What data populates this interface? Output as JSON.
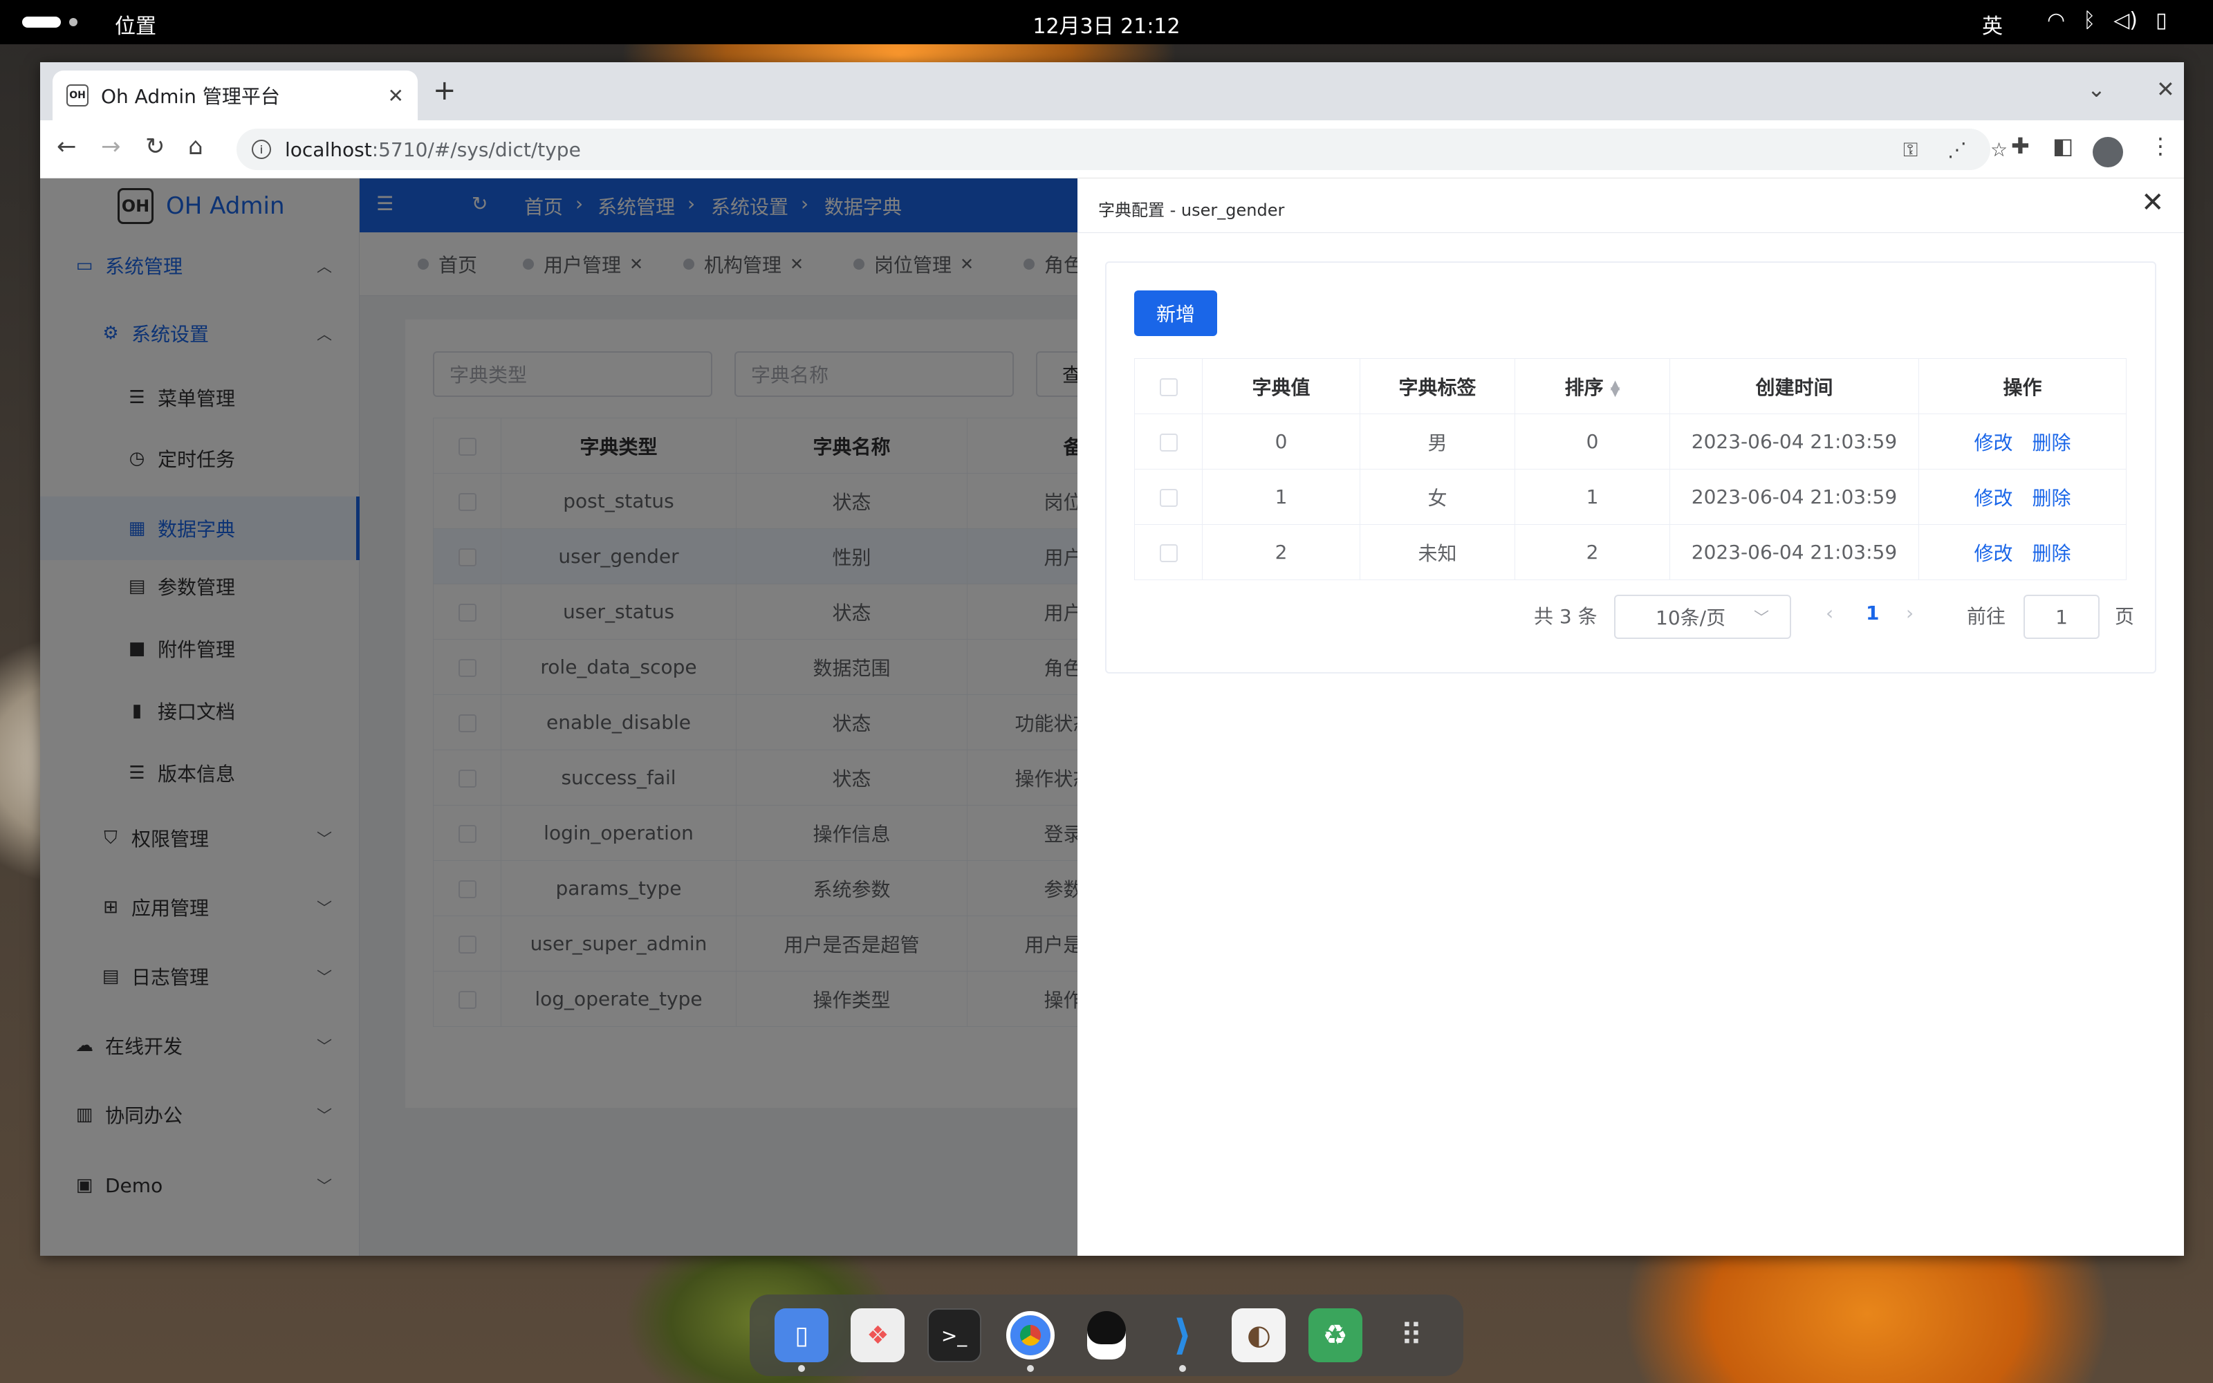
{
  "topbar": {
    "location": "位置",
    "datetime": "12月3日  21:12",
    "ime": "英"
  },
  "browser": {
    "tab_title": "Oh Admin 管理平台",
    "tab_favicon": "OH",
    "url_host": "localhost",
    "url_path": ":5710/#/sys/dict/type"
  },
  "app": {
    "logo_text": "OH Admin",
    "logo_mark": "OH",
    "menu": [
      {
        "label": "系统管理",
        "icon": "monitor-icon"
      },
      {
        "label": "系统设置",
        "icon": "gear-icon"
      },
      {
        "label": "菜单管理",
        "icon": "list-icon"
      },
      {
        "label": "定时任务",
        "icon": "clock-icon"
      },
      {
        "label": "数据字典",
        "icon": "grid-icon"
      },
      {
        "label": "参数管理",
        "icon": "document-icon"
      },
      {
        "label": "附件管理",
        "icon": "folder-icon"
      },
      {
        "label": "接口文档",
        "icon": "file-icon"
      },
      {
        "label": "版本信息",
        "icon": "list-icon"
      },
      {
        "label": "权限管理",
        "icon": "shield-icon"
      },
      {
        "label": "应用管理",
        "icon": "apps-icon"
      },
      {
        "label": "日志管理",
        "icon": "log-icon"
      },
      {
        "label": "在线开发",
        "icon": "cloud-icon"
      },
      {
        "label": "协同办公",
        "icon": "building-icon"
      },
      {
        "label": "Demo",
        "icon": "dashboard-icon"
      }
    ],
    "breadcrumb": [
      "首页",
      "系统管理",
      "系统设置",
      "数据字典"
    ],
    "tags": [
      "首页",
      "用户管理",
      "机构管理",
      "岗位管理",
      "角色管"
    ],
    "search": {
      "type_placeholder": "字典类型",
      "name_placeholder": "字典名称",
      "query_label": "查询"
    },
    "table": {
      "headers": [
        "字典类型",
        "字典名称",
        "备注"
      ],
      "rows": [
        [
          "post_status",
          "状态",
          "岗位管理"
        ],
        [
          "user_gender",
          "性别",
          "用户管理"
        ],
        [
          "user_status",
          "状态",
          "用户管理"
        ],
        [
          "role_data_scope",
          "数据范围",
          "角色管理"
        ],
        [
          "enable_disable",
          "状态",
          "功能状态：启用"
        ],
        [
          "success_fail",
          "状态",
          "操作状态：成功"
        ],
        [
          "login_operation",
          "操作信息",
          "登录管理"
        ],
        [
          "params_type",
          "系统参数",
          "参数管理"
        ],
        [
          "user_super_admin",
          "用户是否是超管",
          "用户是否是超"
        ],
        [
          "log_operate_type",
          "操作类型",
          "操作日志"
        ]
      ]
    }
  },
  "drawer": {
    "title": "字典配置 - user_gender",
    "add_label": "新增",
    "headers": [
      "字典值",
      "字典标签",
      "排序",
      "创建时间",
      "操作"
    ],
    "rows": [
      [
        "0",
        "男",
        "0",
        "2023-06-04 21:03:59"
      ],
      [
        "1",
        "女",
        "1",
        "2023-06-04 21:03:59"
      ],
      [
        "2",
        "未知",
        "2",
        "2023-06-04 21:03:59"
      ]
    ],
    "edit_label": "修改",
    "delete_label": "删除",
    "pagination": {
      "total": "共 3 条",
      "page_size": "10条/页",
      "current_page": "1",
      "goto_label": "前往",
      "goto_value": "1",
      "page_suffix": "页"
    }
  }
}
